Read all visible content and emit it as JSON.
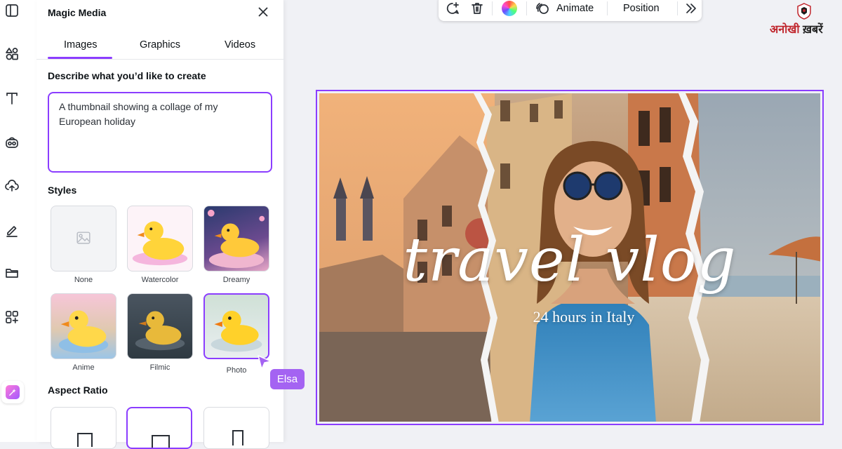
{
  "panel": {
    "title": "Magic Media",
    "tabs": [
      {
        "label": "Images"
      },
      {
        "label": "Graphics"
      },
      {
        "label": "Videos"
      }
    ],
    "prompt_label": "Describe what you’d like to create",
    "prompt_value": "A thumbnail showing a collage of my European holiday",
    "styles_label": "Styles",
    "styles": [
      {
        "label": "None"
      },
      {
        "label": "Watercolor"
      },
      {
        "label": "Dreamy"
      },
      {
        "label": "Anime"
      },
      {
        "label": "Filmic"
      },
      {
        "label": "Photo"
      }
    ],
    "aspect_label": "Aspect Ratio"
  },
  "cursor_tag": "Elsa",
  "toolbar": {
    "animate": "Animate",
    "position": "Position"
  },
  "watermark": {
    "part1": "अनोखी",
    "part2": "ख़बरें"
  },
  "design": {
    "headline": "travel vlog",
    "subhead": "24 hours in Italy"
  },
  "colors": {
    "accent": "#8b3dff",
    "tag": "#a463f2"
  }
}
